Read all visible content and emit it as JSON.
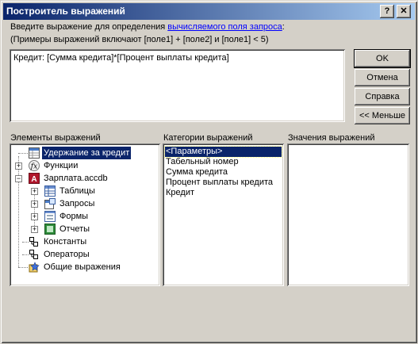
{
  "window": {
    "title": "Построитель выражений",
    "help_glyph": "?",
    "close_glyph": "✕"
  },
  "instructions": {
    "line1_prefix": "Введите выражение для определения ",
    "line1_link": "вычисляемого поля запроса",
    "line1_suffix": ":",
    "line2": "(Примеры выражений включают [поле1] + [поле2] и [поле1] < 5)"
  },
  "expression": {
    "value": "Кредит: [Сумма кредита]*[Процент выплаты кредита]"
  },
  "buttons": {
    "ok": "OK",
    "cancel": "Отмена",
    "help": "Справка",
    "less": "<< Меньше"
  },
  "labels": {
    "elements": "Элементы выражений",
    "categories": "Категории выражений",
    "values": "Значения выражений"
  },
  "elements_tree": [
    {
      "label": "Удержание за кредит",
      "icon": "query-icon",
      "selected": true
    },
    {
      "label": "Функции",
      "icon": "function-icon",
      "expander": "+"
    },
    {
      "label": "Зарплата.accdb",
      "icon": "access-db-icon",
      "expander": "-"
    },
    {
      "label": "Таблицы",
      "icon": "table-icon",
      "expander": "+"
    },
    {
      "label": "Запросы",
      "icon": "query-icon",
      "expander": "+"
    },
    {
      "label": "Формы",
      "icon": "form-icon",
      "expander": "+"
    },
    {
      "label": "Отчеты",
      "icon": "report-icon",
      "expander": "+"
    },
    {
      "label": "Константы",
      "icon": "constants-icon"
    },
    {
      "label": "Операторы",
      "icon": "operators-icon"
    },
    {
      "label": "Общие выражения",
      "icon": "common-expressions-icon"
    }
  ],
  "categories": [
    {
      "label": "<Параметры>",
      "selected": true
    },
    {
      "label": "Табельный номер"
    },
    {
      "label": "Сумма кредита"
    },
    {
      "label": "Процент выплаты кредита"
    },
    {
      "label": "Кредит"
    }
  ],
  "colors": {
    "title_gradient_start": "#0a246a",
    "title_gradient_end": "#a6caf0",
    "selection": "#0a246a",
    "link": "#0000ff",
    "dialog": "#d4d0c8"
  }
}
